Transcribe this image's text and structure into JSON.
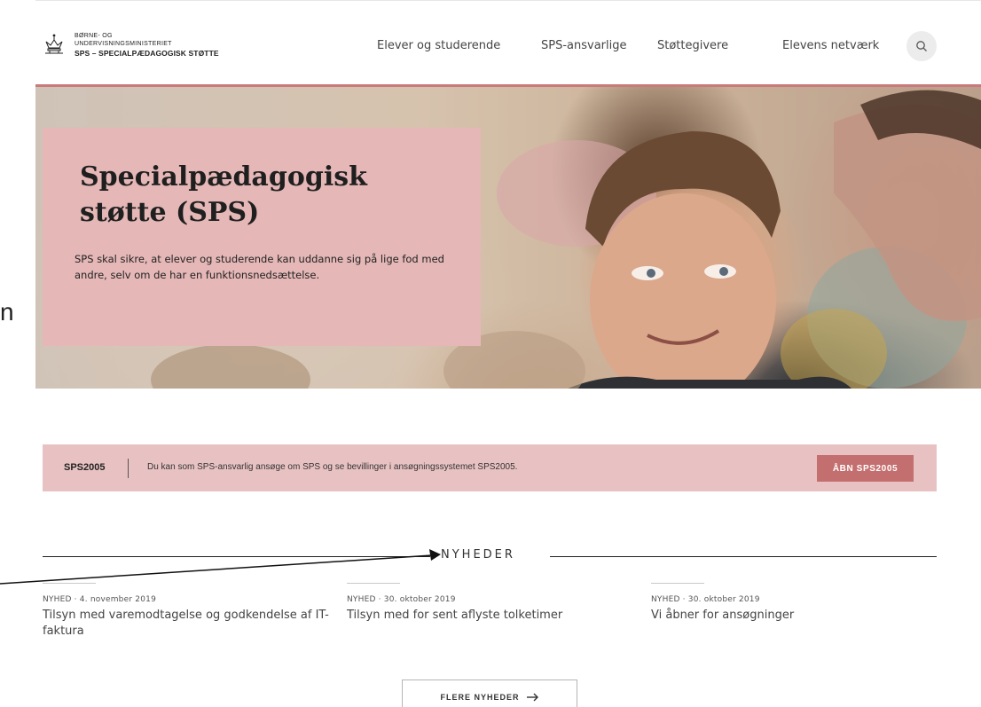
{
  "header": {
    "logo_line1": "BØRNE- OG",
    "logo_line2": "UNDERVISNINGSMINISTERIET",
    "logo_line3": "SPS – SPECIALPÆDAGOGISK STØTTE"
  },
  "nav": {
    "items": [
      {
        "label": "Elever og studerende"
      },
      {
        "label": "SPS-ansvarlige"
      },
      {
        "label": "Støttegivere"
      },
      {
        "label": "Elevens netværk"
      }
    ],
    "search_icon": "search-icon"
  },
  "hero": {
    "title_line1": "Specialpædagogisk",
    "title_line2": "støtte (SPS)",
    "text": "SPS skal sikre, at elever og studerende kan uddanne sig på lige fod med andre, selv om de har en funktionsnedsættelse."
  },
  "cut_letter": "n",
  "banner": {
    "label": "SPS2005",
    "text": "Du kan som SPS-ansvarlig ansøge om SPS og se bevillinger i ansøgningssystemet SPS2005.",
    "button": "ÅBN SPS2005"
  },
  "news": {
    "title": "NYHEDER",
    "items": [
      {
        "meta": "NYHED · 4. november 2019",
        "headline": "Tilsyn med varemodtagelse og godkendelse af IT-faktura"
      },
      {
        "meta": "NYHED · 30. oktober 2019",
        "headline": "Tilsyn med for sent aflyste tolketimer"
      },
      {
        "meta": "NYHED · 30. oktober 2019",
        "headline": "Vi åbner for ansøgninger"
      }
    ],
    "more_button": "FLERE NYHEDER",
    "more_icon": "arrow-right-icon"
  },
  "colors": {
    "accent": "#c46f6f",
    "hero_overlay": "#e5b7b7",
    "banner": "#e8c2c2"
  }
}
